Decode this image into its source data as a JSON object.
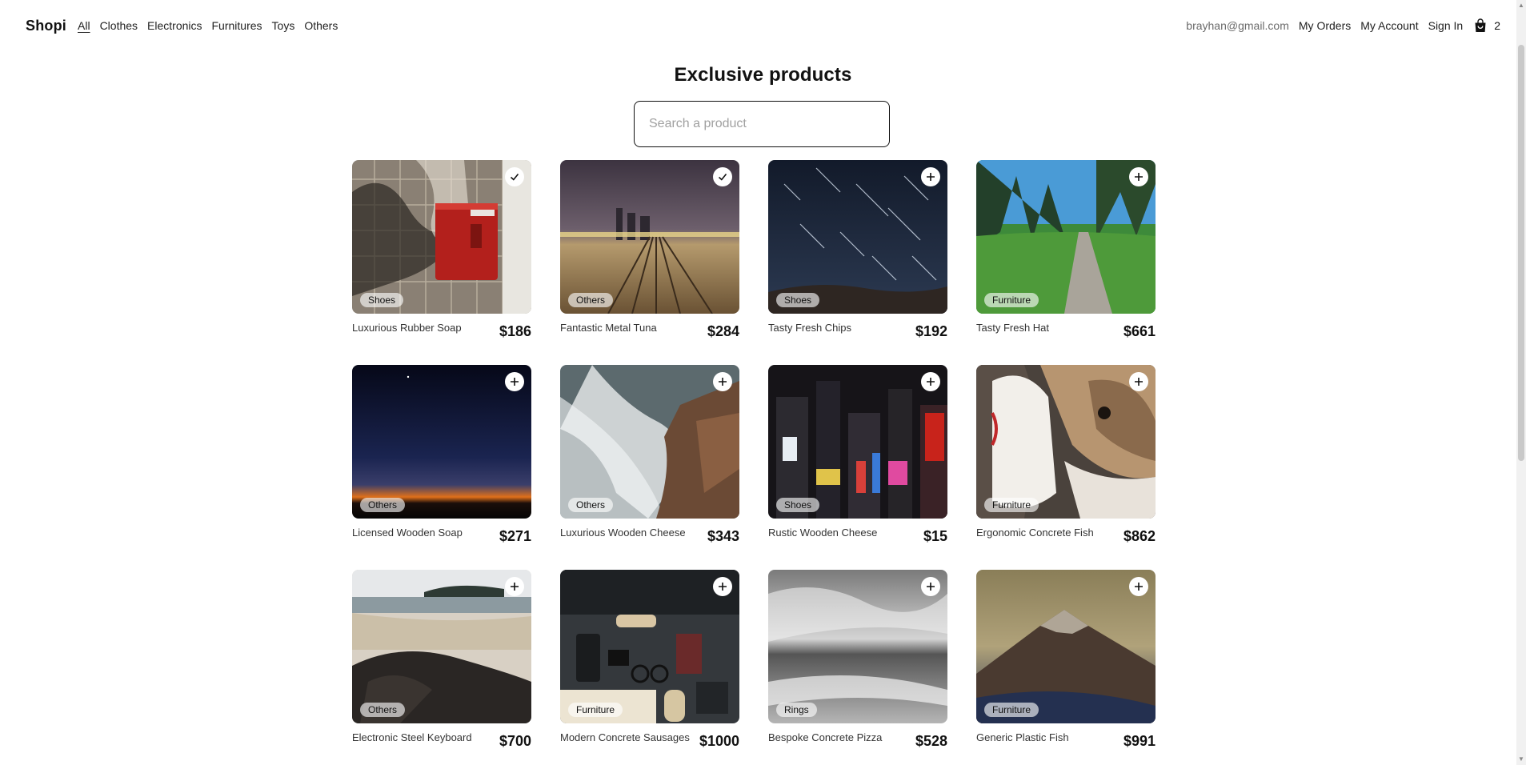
{
  "navbar": {
    "brand": "Shopi",
    "categories": [
      {
        "label": "All",
        "active": true
      },
      {
        "label": "Clothes",
        "active": false
      },
      {
        "label": "Electronics",
        "active": false
      },
      {
        "label": "Furnitures",
        "active": false
      },
      {
        "label": "Toys",
        "active": false
      },
      {
        "label": "Others",
        "active": false
      }
    ],
    "email": "brayhan@gmail.com",
    "my_orders": "My Orders",
    "my_account": "My Account",
    "sign_in": "Sign In",
    "cart_count": "2"
  },
  "main": {
    "title": "Exclusive products",
    "search_placeholder": "Search a product"
  },
  "products": [
    {
      "name": "Luxurious Rubber Soap",
      "price": "$186",
      "category": "Shoes",
      "in_cart": true,
      "image": "red-mailbox-on-tiled-wall"
    },
    {
      "name": "Fantastic Metal Tuna",
      "price": "$284",
      "category": "Others",
      "in_cart": true,
      "image": "railway-tracks-at-dusk"
    },
    {
      "name": "Tasty Fresh Chips",
      "price": "$192",
      "category": "Shoes",
      "in_cart": false,
      "image": "star-trails-night-sky"
    },
    {
      "name": "Tasty Fresh Hat",
      "price": "$661",
      "category": "Furniture",
      "in_cart": false,
      "image": "path-through-green-park"
    },
    {
      "name": "Licensed Wooden Soap",
      "price": "$271",
      "category": "Others",
      "in_cart": false,
      "image": "sunset-horizon-night"
    },
    {
      "name": "Luxurious Wooden Cheese",
      "price": "$343",
      "category": "Others",
      "in_cart": false,
      "image": "waves-crashing-on-rock"
    },
    {
      "name": "Rustic Wooden Cheese",
      "price": "$15",
      "category": "Shoes",
      "in_cart": false,
      "image": "city-lights-times-square"
    },
    {
      "name": "Ergonomic Concrete Fish",
      "price": "$862",
      "category": "Furniture",
      "in_cart": false,
      "image": "bulldog-close-up"
    },
    {
      "name": "Electronic Steel Keyboard",
      "price": "$700",
      "category": "Others",
      "in_cart": false,
      "image": "beach-with-rocks"
    },
    {
      "name": "Modern Concrete Sausages",
      "price": "$1000",
      "category": "Furniture",
      "in_cart": false,
      "image": "desk-flatlay-keyboard-glasses"
    },
    {
      "name": "Bespoke Concrete Pizza",
      "price": "$528",
      "category": "Rings",
      "in_cart": false,
      "image": "black-and-white-sea"
    },
    {
      "name": "Generic Plastic Fish",
      "price": "$991",
      "category": "Furniture",
      "in_cart": false,
      "image": "misty-mountain-peak"
    }
  ]
}
